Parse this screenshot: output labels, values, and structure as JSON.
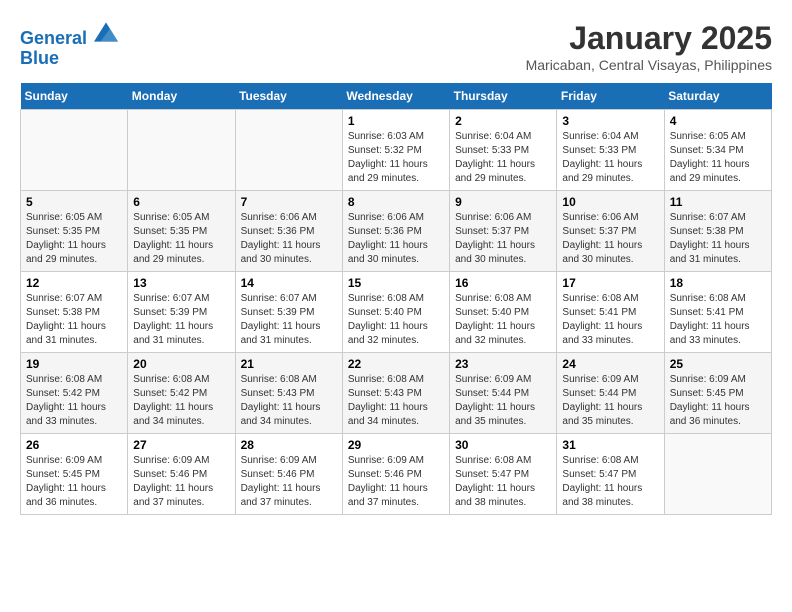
{
  "header": {
    "logo_line1": "General",
    "logo_line2": "Blue",
    "month": "January 2025",
    "location": "Maricaban, Central Visayas, Philippines"
  },
  "days_of_week": [
    "Sunday",
    "Monday",
    "Tuesday",
    "Wednesday",
    "Thursday",
    "Friday",
    "Saturday"
  ],
  "weeks": [
    [
      {
        "day": "",
        "sunrise": "",
        "sunset": "",
        "daylight": ""
      },
      {
        "day": "",
        "sunrise": "",
        "sunset": "",
        "daylight": ""
      },
      {
        "day": "",
        "sunrise": "",
        "sunset": "",
        "daylight": ""
      },
      {
        "day": "1",
        "sunrise": "Sunrise: 6:03 AM",
        "sunset": "Sunset: 5:32 PM",
        "daylight": "Daylight: 11 hours and 29 minutes."
      },
      {
        "day": "2",
        "sunrise": "Sunrise: 6:04 AM",
        "sunset": "Sunset: 5:33 PM",
        "daylight": "Daylight: 11 hours and 29 minutes."
      },
      {
        "day": "3",
        "sunrise": "Sunrise: 6:04 AM",
        "sunset": "Sunset: 5:33 PM",
        "daylight": "Daylight: 11 hours and 29 minutes."
      },
      {
        "day": "4",
        "sunrise": "Sunrise: 6:05 AM",
        "sunset": "Sunset: 5:34 PM",
        "daylight": "Daylight: 11 hours and 29 minutes."
      }
    ],
    [
      {
        "day": "5",
        "sunrise": "Sunrise: 6:05 AM",
        "sunset": "Sunset: 5:35 PM",
        "daylight": "Daylight: 11 hours and 29 minutes."
      },
      {
        "day": "6",
        "sunrise": "Sunrise: 6:05 AM",
        "sunset": "Sunset: 5:35 PM",
        "daylight": "Daylight: 11 hours and 29 minutes."
      },
      {
        "day": "7",
        "sunrise": "Sunrise: 6:06 AM",
        "sunset": "Sunset: 5:36 PM",
        "daylight": "Daylight: 11 hours and 30 minutes."
      },
      {
        "day": "8",
        "sunrise": "Sunrise: 6:06 AM",
        "sunset": "Sunset: 5:36 PM",
        "daylight": "Daylight: 11 hours and 30 minutes."
      },
      {
        "day": "9",
        "sunrise": "Sunrise: 6:06 AM",
        "sunset": "Sunset: 5:37 PM",
        "daylight": "Daylight: 11 hours and 30 minutes."
      },
      {
        "day": "10",
        "sunrise": "Sunrise: 6:06 AM",
        "sunset": "Sunset: 5:37 PM",
        "daylight": "Daylight: 11 hours and 30 minutes."
      },
      {
        "day": "11",
        "sunrise": "Sunrise: 6:07 AM",
        "sunset": "Sunset: 5:38 PM",
        "daylight": "Daylight: 11 hours and 31 minutes."
      }
    ],
    [
      {
        "day": "12",
        "sunrise": "Sunrise: 6:07 AM",
        "sunset": "Sunset: 5:38 PM",
        "daylight": "Daylight: 11 hours and 31 minutes."
      },
      {
        "day": "13",
        "sunrise": "Sunrise: 6:07 AM",
        "sunset": "Sunset: 5:39 PM",
        "daylight": "Daylight: 11 hours and 31 minutes."
      },
      {
        "day": "14",
        "sunrise": "Sunrise: 6:07 AM",
        "sunset": "Sunset: 5:39 PM",
        "daylight": "Daylight: 11 hours and 31 minutes."
      },
      {
        "day": "15",
        "sunrise": "Sunrise: 6:08 AM",
        "sunset": "Sunset: 5:40 PM",
        "daylight": "Daylight: 11 hours and 32 minutes."
      },
      {
        "day": "16",
        "sunrise": "Sunrise: 6:08 AM",
        "sunset": "Sunset: 5:40 PM",
        "daylight": "Daylight: 11 hours and 32 minutes."
      },
      {
        "day": "17",
        "sunrise": "Sunrise: 6:08 AM",
        "sunset": "Sunset: 5:41 PM",
        "daylight": "Daylight: 11 hours and 33 minutes."
      },
      {
        "day": "18",
        "sunrise": "Sunrise: 6:08 AM",
        "sunset": "Sunset: 5:41 PM",
        "daylight": "Daylight: 11 hours and 33 minutes."
      }
    ],
    [
      {
        "day": "19",
        "sunrise": "Sunrise: 6:08 AM",
        "sunset": "Sunset: 5:42 PM",
        "daylight": "Daylight: 11 hours and 33 minutes."
      },
      {
        "day": "20",
        "sunrise": "Sunrise: 6:08 AM",
        "sunset": "Sunset: 5:42 PM",
        "daylight": "Daylight: 11 hours and 34 minutes."
      },
      {
        "day": "21",
        "sunrise": "Sunrise: 6:08 AM",
        "sunset": "Sunset: 5:43 PM",
        "daylight": "Daylight: 11 hours and 34 minutes."
      },
      {
        "day": "22",
        "sunrise": "Sunrise: 6:08 AM",
        "sunset": "Sunset: 5:43 PM",
        "daylight": "Daylight: 11 hours and 34 minutes."
      },
      {
        "day": "23",
        "sunrise": "Sunrise: 6:09 AM",
        "sunset": "Sunset: 5:44 PM",
        "daylight": "Daylight: 11 hours and 35 minutes."
      },
      {
        "day": "24",
        "sunrise": "Sunrise: 6:09 AM",
        "sunset": "Sunset: 5:44 PM",
        "daylight": "Daylight: 11 hours and 35 minutes."
      },
      {
        "day": "25",
        "sunrise": "Sunrise: 6:09 AM",
        "sunset": "Sunset: 5:45 PM",
        "daylight": "Daylight: 11 hours and 36 minutes."
      }
    ],
    [
      {
        "day": "26",
        "sunrise": "Sunrise: 6:09 AM",
        "sunset": "Sunset: 5:45 PM",
        "daylight": "Daylight: 11 hours and 36 minutes."
      },
      {
        "day": "27",
        "sunrise": "Sunrise: 6:09 AM",
        "sunset": "Sunset: 5:46 PM",
        "daylight": "Daylight: 11 hours and 37 minutes."
      },
      {
        "day": "28",
        "sunrise": "Sunrise: 6:09 AM",
        "sunset": "Sunset: 5:46 PM",
        "daylight": "Daylight: 11 hours and 37 minutes."
      },
      {
        "day": "29",
        "sunrise": "Sunrise: 6:09 AM",
        "sunset": "Sunset: 5:46 PM",
        "daylight": "Daylight: 11 hours and 37 minutes."
      },
      {
        "day": "30",
        "sunrise": "Sunrise: 6:08 AM",
        "sunset": "Sunset: 5:47 PM",
        "daylight": "Daylight: 11 hours and 38 minutes."
      },
      {
        "day": "31",
        "sunrise": "Sunrise: 6:08 AM",
        "sunset": "Sunset: 5:47 PM",
        "daylight": "Daylight: 11 hours and 38 minutes."
      },
      {
        "day": "",
        "sunrise": "",
        "sunset": "",
        "daylight": ""
      }
    ]
  ]
}
